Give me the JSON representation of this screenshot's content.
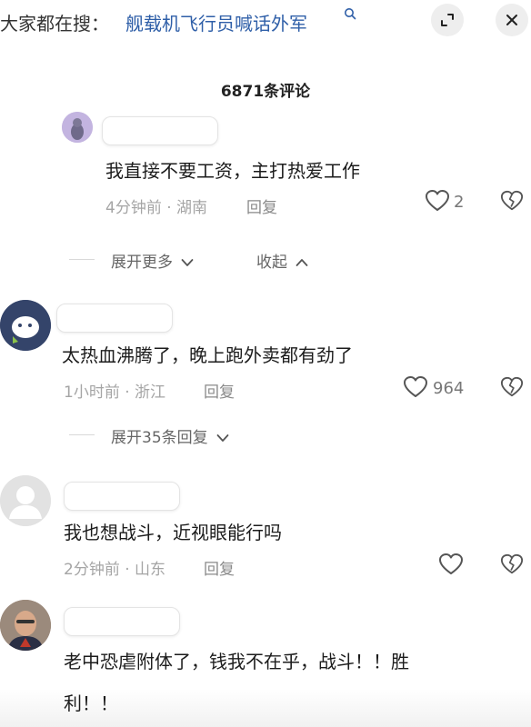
{
  "search": {
    "prefix": "大家都在搜：",
    "term": "舰载机飞行员喊话外军"
  },
  "comments_count": "6871条评论",
  "comments": [
    {
      "text": "我直接不要工资，主打热爱工作",
      "meta": "4分钟前 · 湖南",
      "reply": "回复",
      "likes": "2"
    },
    {
      "text": "太热血沸腾了，晚上跑外卖都有劲了",
      "meta": "1小时前 · 浙江",
      "reply": "回复",
      "likes": "964"
    },
    {
      "text": "我也想战斗，近视眼能行吗",
      "meta": "2分钟前 · 山东",
      "reply": "回复",
      "likes": ""
    },
    {
      "text_line1": "老中恐虐附体了，钱我不在乎，战斗！！胜",
      "text_line2": "利！！"
    }
  ],
  "expand_more": "展开更多",
  "collapse": "收起",
  "expand_replies": "展开35条回复",
  "colors": {
    "link": "#2f5fa8",
    "meta": "#a5a5a5",
    "icon": "#555555"
  }
}
